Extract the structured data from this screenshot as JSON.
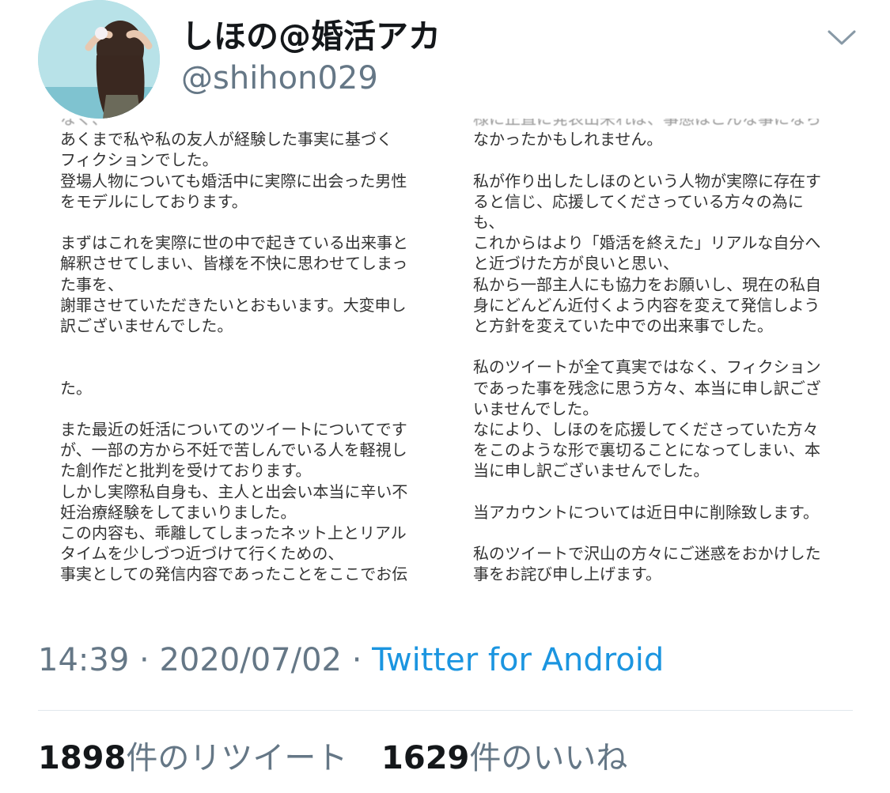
{
  "tweet": {
    "author": {
      "display_name": "しほの@婚活アカ",
      "handle": "@shihon029"
    },
    "media": {
      "left": {
        "top_cut": "なく、",
        "blocks1": [
          "あくまで私や私の友人が経験した事実に基づく\nフィクションでした。\n登場人物についても婚活中に実際に出会った男性\nをモデルにしております。",
          "まずはこれを実際に世の中で起きている出来事と\n解釈させてしまい、皆様を不快に思わせてしまっ\nた事を、\n謝罪させていただきたいとおもいます。大変申し\n訳ございませんでした。"
        ],
        "mid_cut": "",
        "blocks2": [
          "た。",
          "また最近の妊活についてのツイートについてです\nが、一部の方から不妊で苦しんでいる人を軽視し\nた創作だと批判を受けております。\nしかし実際私自身も、主人と出会い本当に辛い不\n妊治療経験をしてまいりました。\nこの内容も、乖離してしまったネット上とリアル\nタイムを少しづつ近づけて行くための、\n事実としての発信内容であったことをここでお伝\nえしておきます。"
        ]
      },
      "right": {
        "top_cut": "様に正直に発表出来れば、事態はこんな事になら",
        "blocks": [
          "なかったかもしれません。",
          "私が作り出したしほのという人物が実際に存在す\nると信じ、応援してくださっている方々の為に\nも、\nこれからはより「婚活を終えた」リアルな自分へ\nと近づけた方が良いと思い、\n私から一部主人にも協力をお願いし、現在の私自\n身にどんどん近付くよう内容を変えて発信しよう\nと方針を変えていた中での出来事でした。",
          "私のツイートが全て真実ではなく、フィクション\nであった事を残念に思う方々、本当に申し訳ござ\nいませんでした。\nなにより、しほのを応援してくださっていた方々\nをこのような形で裏切ることになってしまい、本\n当に申し訳ございませんでした。",
          "当アカウントについては近日中に削除致します。",
          "私のツイートで沢山の方々にご迷惑をおかけした\n事をお詫び申し上げます。"
        ]
      }
    },
    "time": "14:39",
    "date": "2020/07/02",
    "separator": " · ",
    "source": "Twitter for Android",
    "retweets": {
      "count": "1898",
      "label": "件のリツイート"
    },
    "likes": {
      "count": "1629",
      "label": "件のいいね"
    }
  },
  "icons": {
    "menu": "chevron-down-icon"
  },
  "colors": {
    "name": "#14171a",
    "secondary": "#657786",
    "link": "#1b95e0",
    "divider": "#e1e8ed"
  }
}
